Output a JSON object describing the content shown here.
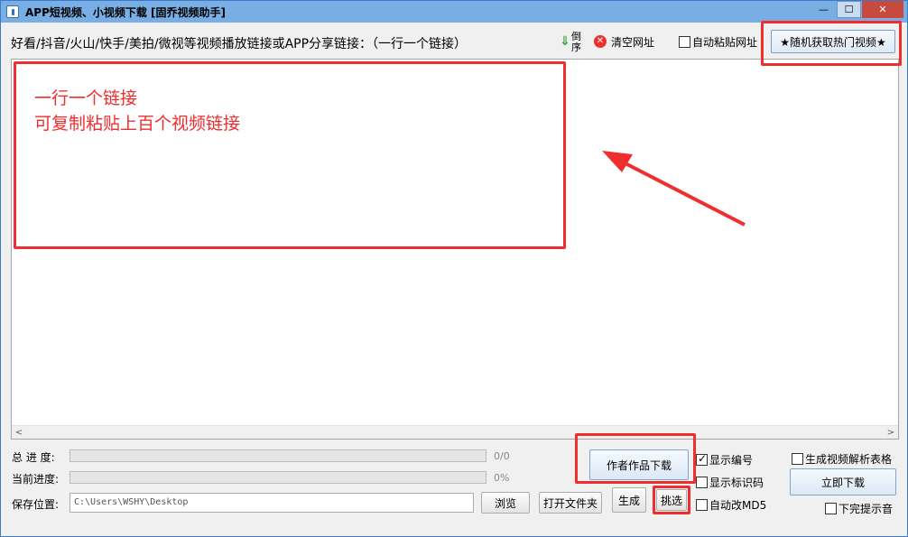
{
  "window": {
    "title": "APP短视频、小视频下载 [固乔视频助手]",
    "minimize_glyph": "—",
    "maximize_glyph": "☐",
    "close_glyph": "✕"
  },
  "toolbar": {
    "prompt": "好看/抖音/火山/快手/美拍/微视等视频播放链接或APP分享链接：（一行一个链接）",
    "reverse_label": "倒序",
    "reverse_icon": "arrow-down-icon",
    "clear_label": "清空网址",
    "clear_icon_glyph": "✕",
    "autopaste_label": "自动粘贴网址",
    "hot_button_label": "★随机获取热门视频★"
  },
  "textarea": {
    "hint_lines": [
      "一行一个链接",
      "可复制粘贴上百个视频链接"
    ],
    "scroll_left": "<",
    "scroll_right": ">"
  },
  "progress": {
    "total_label": "总 进 度:",
    "total_text": "0/0",
    "total_value": 0,
    "current_label": "当前进度:",
    "current_text": "0%",
    "current_value": 0
  },
  "save": {
    "label": "保存位置:",
    "path": "C:\\Users\\WSHY\\Desktop",
    "browse_label": "浏览",
    "open_folder_label": "打开文件夹",
    "generate_label": "生成",
    "pick_label": "挑选"
  },
  "actions": {
    "author_download_label": "作者作品下载",
    "show_number_label": "显示编号",
    "show_number_checked": true,
    "show_mark_label": "显示标识码",
    "show_mark_checked": false,
    "auto_md5_label": "自动改MD5",
    "auto_md5_checked": false,
    "gen_table_label": "生成视频解析表格",
    "gen_table_checked": false,
    "download_now_label": "立即下载",
    "finish_sound_label": "下完提示音",
    "finish_sound_checked": false
  },
  "colors": {
    "annotation_red": "#ef2f2f",
    "titlebar": "#78aee3",
    "progress_fill": "#06b025"
  }
}
